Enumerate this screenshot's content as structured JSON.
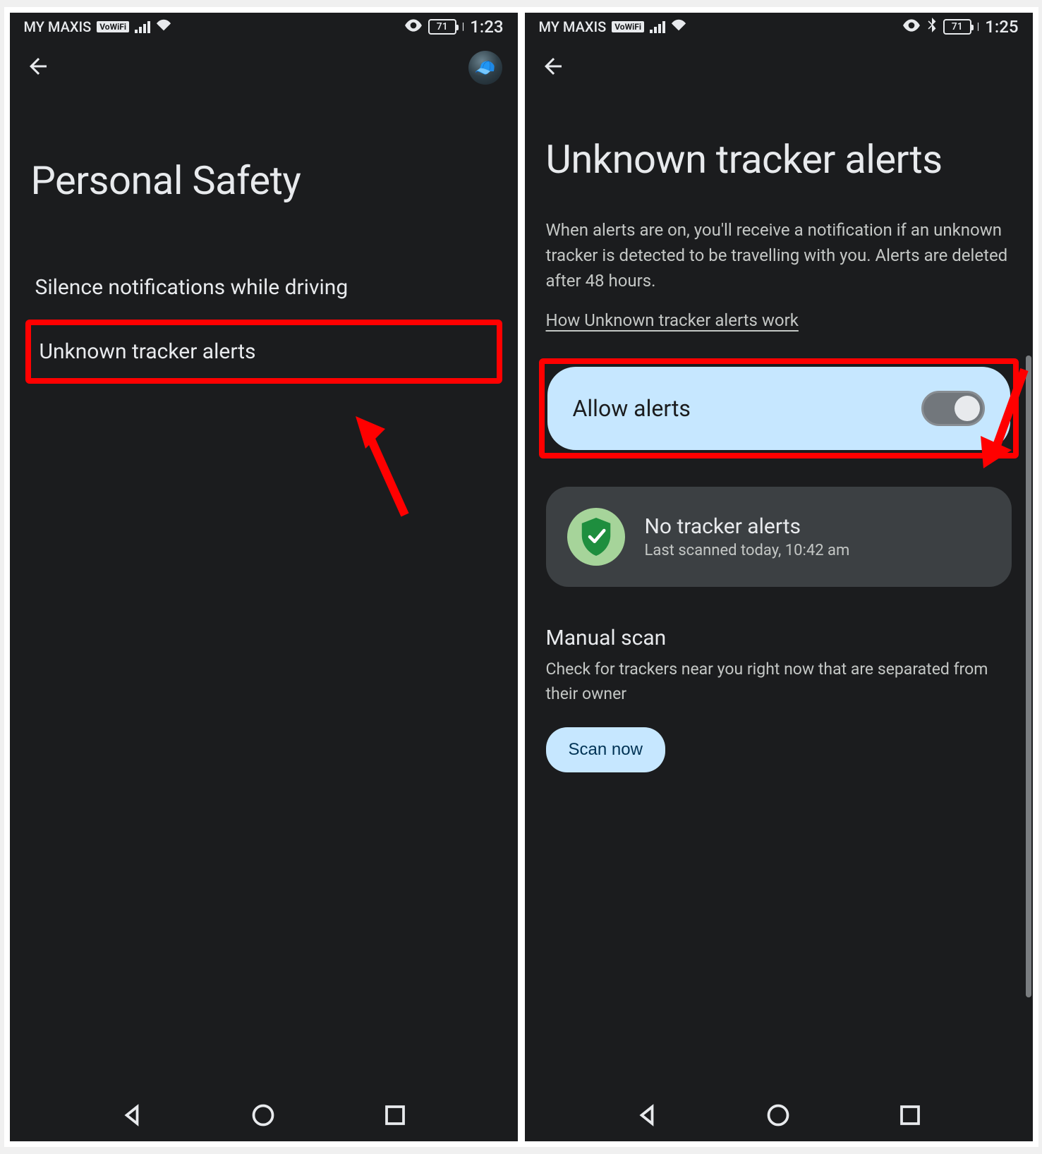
{
  "left": {
    "status": {
      "carrier": "MY MAXIS",
      "vowifi": "VoWiFi",
      "battery": "71",
      "time": "1:23"
    },
    "title": "Personal Safety",
    "items": [
      {
        "label": "Silence notifications while driving"
      },
      {
        "label": "Unknown tracker alerts"
      }
    ]
  },
  "right": {
    "status": {
      "carrier": "MY MAXIS",
      "vowifi": "VoWiFi",
      "battery": "71",
      "time": "1:25"
    },
    "title": "Unknown tracker alerts",
    "description": "When alerts are on, you'll receive a notification if an unknown tracker is detected to be travelling with you. Alerts are deleted after 48 hours.",
    "help_link": "How Unknown tracker alerts work",
    "toggle": {
      "label": "Allow alerts",
      "on": true
    },
    "status_card": {
      "title": "No tracker alerts",
      "subtitle": "Last scanned today, 10:42 am"
    },
    "manual": {
      "heading": "Manual scan",
      "subtitle": "Check for trackers near you right now that are separated from their owner",
      "button": "Scan now"
    }
  },
  "annotations": {
    "color": "#ff0000"
  }
}
